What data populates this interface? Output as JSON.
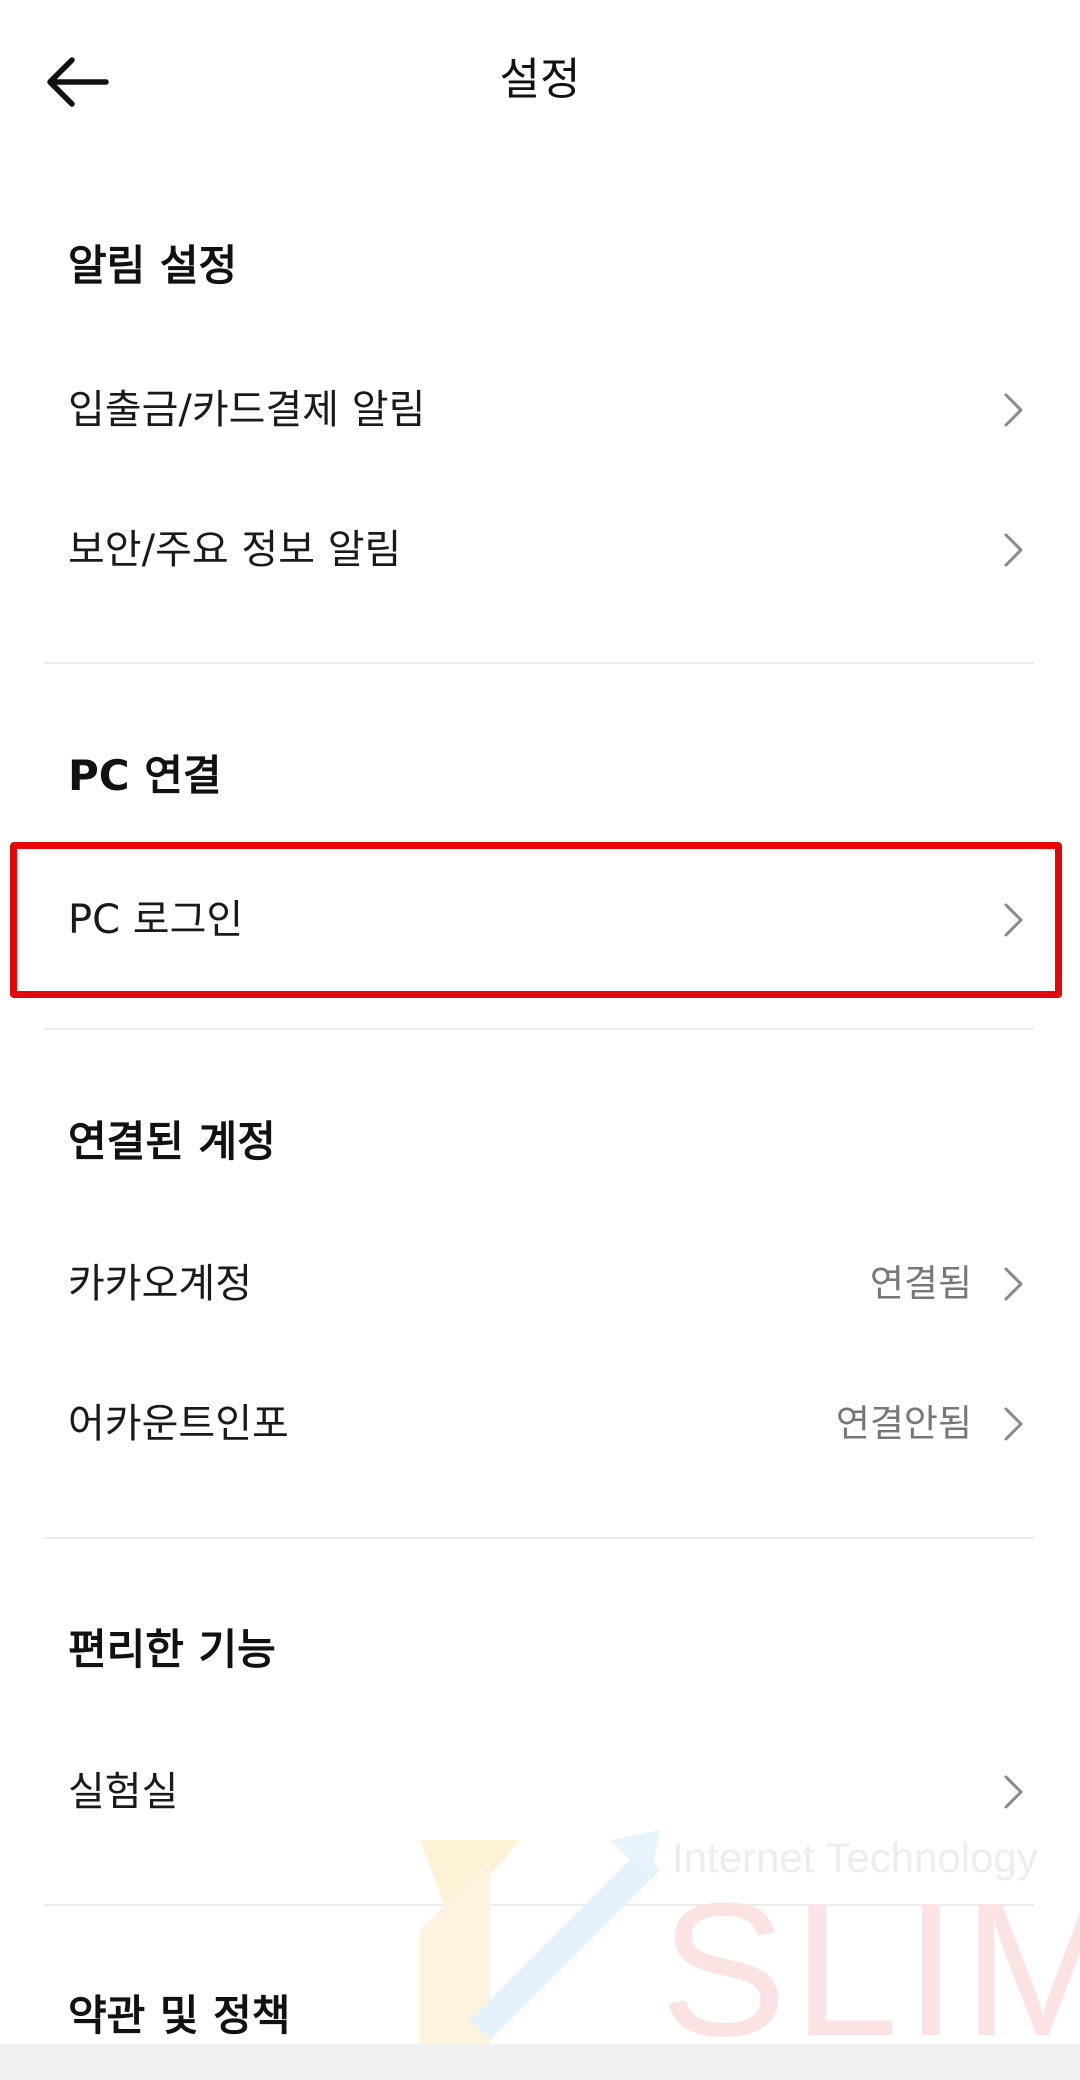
{
  "header": {
    "title": "설정",
    "back_icon": "arrow-left-icon"
  },
  "sections": [
    {
      "title": "알림 설정",
      "items": [
        {
          "label": "입출금/카드결제 알림",
          "value": ""
        },
        {
          "label": "보안/주요 정보 알림",
          "value": ""
        }
      ]
    },
    {
      "title": "PC 연결",
      "items": [
        {
          "label": "PC 로그인",
          "value": ""
        }
      ]
    },
    {
      "title": "연결된 계정",
      "items": [
        {
          "label": "카카오계정",
          "value": "연결됨"
        },
        {
          "label": "어카운트인포",
          "value": "연결안됨"
        }
      ]
    },
    {
      "title": "편리한 기능",
      "items": [
        {
          "label": "실험실",
          "value": ""
        }
      ]
    },
    {
      "title": "약관 및 정책",
      "items": []
    }
  ],
  "watermark": {
    "text": "Internet Technology",
    "brand": "SLIM"
  },
  "colors": {
    "highlight": "#e4080a",
    "divider": "#ececec",
    "secondary_text": "#777777"
  }
}
